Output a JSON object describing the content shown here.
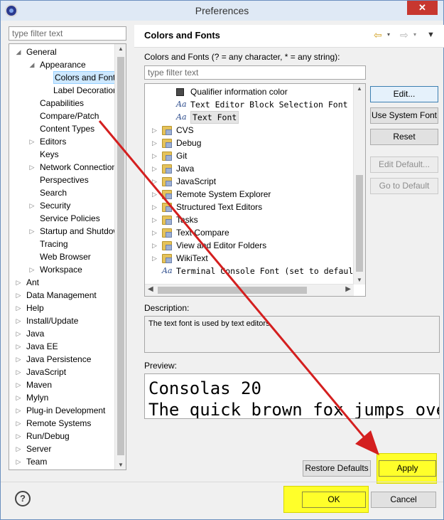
{
  "window": {
    "title": "Preferences",
    "close_label": "✕"
  },
  "left": {
    "filter_placeholder": "type filter text",
    "tree": [
      {
        "label": "General",
        "indent": 0,
        "arrow": "◢"
      },
      {
        "label": "Appearance",
        "indent": 1,
        "arrow": "◢"
      },
      {
        "label": "Colors and Fonts",
        "indent": 2,
        "arrow": "",
        "selected": true
      },
      {
        "label": "Label Decorations",
        "indent": 2,
        "arrow": ""
      },
      {
        "label": "Capabilities",
        "indent": 1,
        "arrow": ""
      },
      {
        "label": "Compare/Patch",
        "indent": 1,
        "arrow": ""
      },
      {
        "label": "Content Types",
        "indent": 1,
        "arrow": ""
      },
      {
        "label": "Editors",
        "indent": 1,
        "arrow": "▷"
      },
      {
        "label": "Keys",
        "indent": 1,
        "arrow": ""
      },
      {
        "label": "Network Connections",
        "indent": 1,
        "arrow": "▷"
      },
      {
        "label": "Perspectives",
        "indent": 1,
        "arrow": ""
      },
      {
        "label": "Search",
        "indent": 1,
        "arrow": ""
      },
      {
        "label": "Security",
        "indent": 1,
        "arrow": "▷"
      },
      {
        "label": "Service Policies",
        "indent": 1,
        "arrow": ""
      },
      {
        "label": "Startup and Shutdown",
        "indent": 1,
        "arrow": "▷"
      },
      {
        "label": "Tracing",
        "indent": 1,
        "arrow": ""
      },
      {
        "label": "Web Browser",
        "indent": 1,
        "arrow": ""
      },
      {
        "label": "Workspace",
        "indent": 1,
        "arrow": "▷"
      },
      {
        "label": "Ant",
        "indent": 0,
        "arrow": "▷"
      },
      {
        "label": "Data Management",
        "indent": 0,
        "arrow": "▷"
      },
      {
        "label": "Help",
        "indent": 0,
        "arrow": "▷"
      },
      {
        "label": "Install/Update",
        "indent": 0,
        "arrow": "▷"
      },
      {
        "label": "Java",
        "indent": 0,
        "arrow": "▷"
      },
      {
        "label": "Java EE",
        "indent": 0,
        "arrow": "▷"
      },
      {
        "label": "Java Persistence",
        "indent": 0,
        "arrow": "▷"
      },
      {
        "label": "JavaScript",
        "indent": 0,
        "arrow": "▷"
      },
      {
        "label": "Maven",
        "indent": 0,
        "arrow": "▷"
      },
      {
        "label": "Mylyn",
        "indent": 0,
        "arrow": "▷"
      },
      {
        "label": "Plug-in Development",
        "indent": 0,
        "arrow": "▷"
      },
      {
        "label": "Remote Systems",
        "indent": 0,
        "arrow": "▷"
      },
      {
        "label": "Run/Debug",
        "indent": 0,
        "arrow": "▷"
      },
      {
        "label": "Server",
        "indent": 0,
        "arrow": "▷"
      },
      {
        "label": "Team",
        "indent": 0,
        "arrow": "▷"
      }
    ]
  },
  "right": {
    "title": "Colors and Fonts",
    "filter_caption": "Colors and Fonts (? = any character, * = any string):",
    "filter_placeholder": "type filter text",
    "font_tree": [
      {
        "label": "Qualifier information color",
        "kind": "color",
        "level": 2,
        "mono": false
      },
      {
        "label": "Text Editor Block Selection Font",
        "kind": "font",
        "level": 2,
        "mono": true
      },
      {
        "label": "Text Font",
        "kind": "font",
        "level": 2,
        "mono": true,
        "selected": true
      },
      {
        "label": "CVS",
        "kind": "folder",
        "level": 1,
        "mono": false
      },
      {
        "label": "Debug",
        "kind": "folder",
        "level": 1,
        "mono": false
      },
      {
        "label": "Git",
        "kind": "folder",
        "level": 1,
        "mono": false
      },
      {
        "label": "Java",
        "kind": "folder",
        "level": 1,
        "mono": false
      },
      {
        "label": "JavaScript",
        "kind": "folder",
        "level": 1,
        "mono": false
      },
      {
        "label": "Remote System Explorer",
        "kind": "folder",
        "level": 1,
        "mono": false
      },
      {
        "label": "Structured Text Editors",
        "kind": "folder",
        "level": 1,
        "mono": false
      },
      {
        "label": "Tasks",
        "kind": "folder",
        "level": 1,
        "mono": false
      },
      {
        "label": "Text Compare",
        "kind": "folder",
        "level": 1,
        "mono": false
      },
      {
        "label": "View and Editor Folders",
        "kind": "folder",
        "level": 1,
        "mono": false
      },
      {
        "label": "WikiText",
        "kind": "folder",
        "level": 1,
        "mono": false
      },
      {
        "label": "Terminal Console Font (set to default: Text Font)",
        "kind": "font",
        "level": 0,
        "mono": true
      }
    ],
    "buttons": {
      "edit": "Edit...",
      "use_system_font": "Use System Font",
      "reset": "Reset",
      "edit_default": "Edit Default...",
      "go_to_default": "Go to Default"
    },
    "description_label": "Description:",
    "description_text": "The text font is used by text editors.",
    "preview_label": "Preview:",
    "preview_lines": [
      "Consolas 20",
      "The quick brown fox jumps over the lazy dog."
    ],
    "restore_defaults": "Restore Defaults",
    "apply": "Apply"
  },
  "footer": {
    "ok": "OK",
    "cancel": "Cancel",
    "help": "?"
  },
  "colors": {
    "highlight": "#ffff2a",
    "annotation_arrow": "#d41f1f",
    "selection": "#cde8ff"
  },
  "icons": {
    "font_glyph": "Aa",
    "nav_back": "⇦",
    "nav_forward": "⇨",
    "menu_caret": "▾",
    "view_menu": "▼"
  }
}
